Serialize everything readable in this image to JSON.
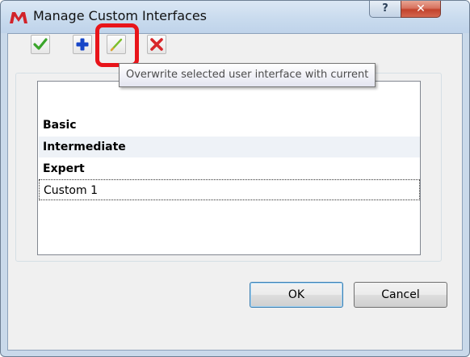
{
  "window": {
    "title": "Manage Custom Interfaces",
    "help_glyph": "?",
    "close_glyph": "✕"
  },
  "toolbar": {
    "buttons": [
      {
        "name": "apply",
        "icon": "check-icon",
        "color": "#3aa52a"
      },
      {
        "name": "add",
        "icon": "plus-icon",
        "color": "#1646c8"
      },
      {
        "name": "overwrite",
        "icon": "pencil-icon",
        "color": "#7cbf2a"
      },
      {
        "name": "delete",
        "icon": "x-icon",
        "color": "#d8262a"
      }
    ]
  },
  "tooltip": {
    "text": "Overwrite selected user interface with current"
  },
  "list": {
    "items": [
      {
        "label": "Basic",
        "bold": true,
        "selected": false
      },
      {
        "label": "Intermediate",
        "bold": true,
        "selected": false
      },
      {
        "label": "Expert",
        "bold": true,
        "selected": false
      },
      {
        "label": "Custom 1",
        "bold": false,
        "selected": true
      }
    ]
  },
  "buttons": {
    "ok_label": "OK",
    "cancel_label": "Cancel"
  },
  "colors": {
    "highlight_ring": "#e8141a",
    "title_bar": "#c9dbee",
    "dialog_face": "#f0f0f0"
  }
}
